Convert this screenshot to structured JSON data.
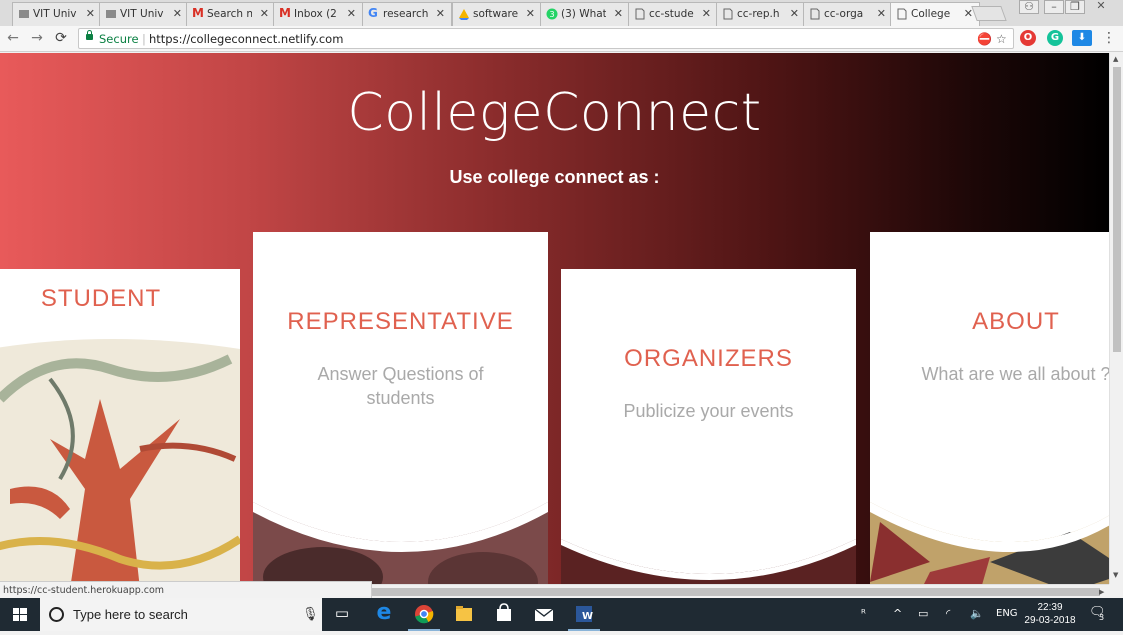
{
  "browser": {
    "tabs": [
      {
        "label": "VIT Univ",
        "icon": "page-icon"
      },
      {
        "label": "VIT Univ",
        "icon": "page-icon"
      },
      {
        "label": "Search n",
        "icon": "gmail-icon"
      },
      {
        "label": "Inbox (2",
        "icon": "gmail-icon"
      },
      {
        "label": "research",
        "icon": "google-icon"
      },
      {
        "label": "software",
        "icon": "drive-icon"
      },
      {
        "label": "(3) What",
        "icon": "whatsapp-icon"
      },
      {
        "label": "cc-stude",
        "icon": "page-icon"
      },
      {
        "label": "cc-rep.h",
        "icon": "page-icon"
      },
      {
        "label": "cc-orga",
        "icon": "page-icon"
      },
      {
        "label": "College",
        "icon": "page-icon"
      }
    ],
    "secure_label": "Secure",
    "url": "https://collegeconnect.netlify.com",
    "status_url": "https://cc-student.herokuapp.com"
  },
  "page": {
    "title": "CollegeConnect",
    "subtitle": "Use college connect as :",
    "cards": [
      {
        "title": "STUDENT",
        "desc": ""
      },
      {
        "title": "REPRESENTATIVE",
        "desc": "Answer Questions of\nstudents"
      },
      {
        "title": "ORGANIZERS",
        "desc": "Publicize your events"
      },
      {
        "title": "ABOUT",
        "desc": "What are we all about ?"
      }
    ]
  },
  "taskbar": {
    "search_placeholder": "Type here to search",
    "language": "ENG",
    "time": "22:39",
    "date": "29-03-2018",
    "notifications": "3"
  }
}
